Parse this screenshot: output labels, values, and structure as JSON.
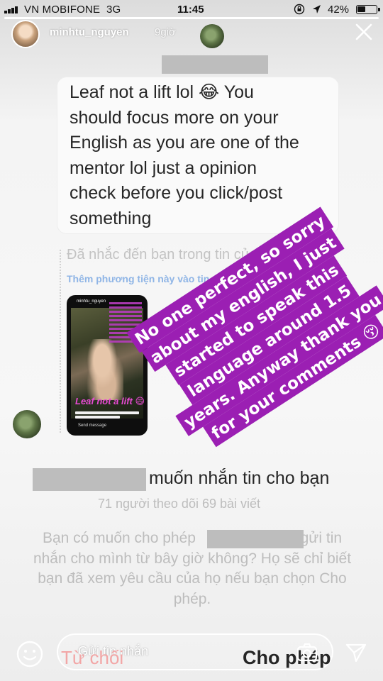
{
  "status_bar": {
    "carrier": "VN MOBIFONE",
    "network": "3G",
    "time": "11:45",
    "battery_percent": "42%"
  },
  "story": {
    "progress_fraction": 1.0,
    "username": "minhtu_nguyen",
    "time_ago": "9giờ",
    "close_icon": "close-icon"
  },
  "dm_message": {
    "lines": [
      "Leaf not a lift lol 😂 You",
      "should focus more on your",
      "English as you are one of the",
      "mentor lol just a opinion",
      "check before you click/post",
      "something"
    ]
  },
  "mention": {
    "text": "Đã nhắc đến bạn trong tin của...",
    "add_media": "Thêm phương tiện này vào tin..."
  },
  "thumbnail": {
    "username": "minhtu_nguyen",
    "caption": "Leaf not a lift 😄",
    "send_label": "Send message"
  },
  "reply_sticker": {
    "lines": [
      "No one perfect, so sorry",
      "about my english, I just",
      "started to speak this",
      "language around 1.5",
      "years. Anyway thank you",
      "for your comments 😚"
    ],
    "color": "#9b1fb3"
  },
  "request": {
    "title": "muốn nhắn tin cho bạn",
    "stats": "71 người theo dõi 69 bài viết",
    "body_line1_before": "Bạn có muốn cho phép",
    "body_line1_after": "gửi tin",
    "body_rest": "nhắn cho mình từ bây giờ không? Họ sẽ chỉ biết bạn đã xem yêu cầu của họ nếu bạn chọn Cho phép.",
    "decline_label": "Từ chối",
    "allow_label": "Cho phép"
  },
  "reply_bar": {
    "placeholder": "Gửi tin nhắn",
    "icons": [
      "smiley-icon",
      "camera-icon",
      "send-icon"
    ]
  }
}
